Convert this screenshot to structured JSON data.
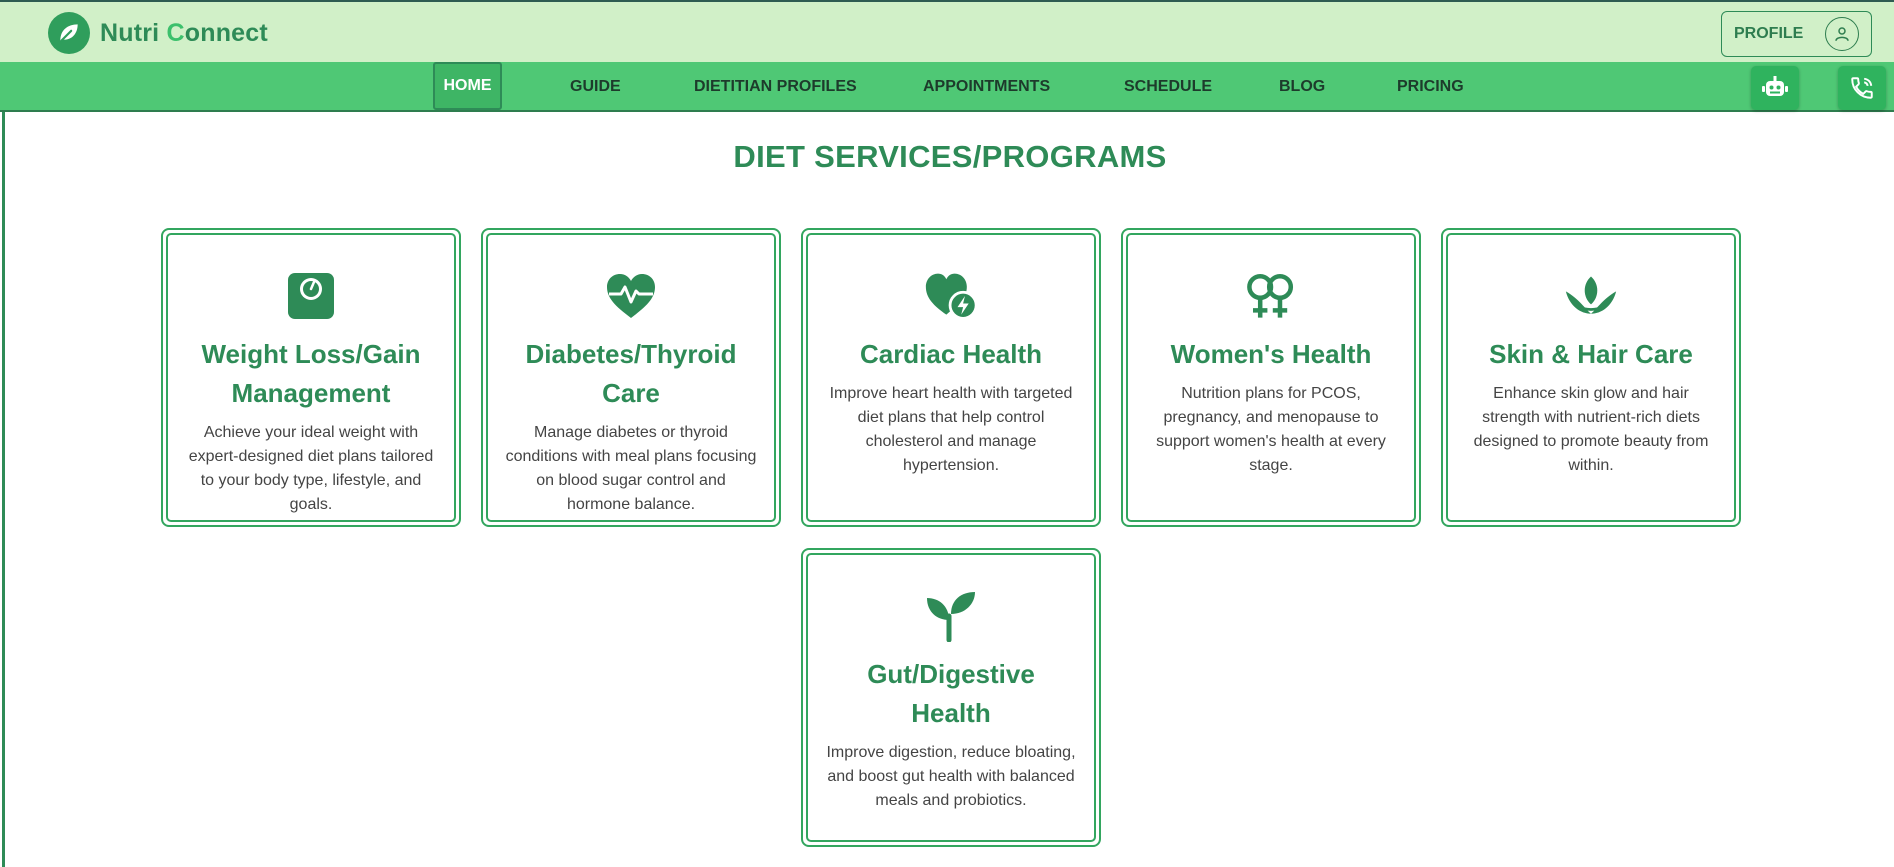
{
  "brand": {
    "name_part1": "Nutri ",
    "name_c": "C",
    "name_part2": "onnect"
  },
  "header": {
    "profile_label": "PROFILE"
  },
  "nav": {
    "items": [
      {
        "label": "HOME",
        "active": true
      },
      {
        "label": "GUIDE"
      },
      {
        "label": "DIETITIAN PROFILES"
      },
      {
        "label": "APPOINTMENTS"
      },
      {
        "label": "SCHEDULE"
      },
      {
        "label": "BLOG"
      },
      {
        "label": "PRICING"
      }
    ],
    "right_icons": [
      "robot-icon",
      "phone-icon"
    ]
  },
  "main": {
    "title": "DIET SERVICES/PROGRAMS",
    "cards": [
      {
        "icon": "weighing-scale-icon",
        "title": "Weight Loss/Gain Management",
        "description": "Achieve your ideal weight with expert-designed diet plans tailored to your body type, lifestyle, and goals."
      },
      {
        "icon": "heart-pulse-icon",
        "title": "Diabetes/Thyroid Care",
        "description": "Manage diabetes or thyroid conditions with meal plans focusing on blood sugar control and hormone balance."
      },
      {
        "icon": "heart-bolt-icon",
        "title": "Cardiac Health",
        "description": "Improve heart health with targeted diet plans that help control cholesterol and manage hypertension."
      },
      {
        "icon": "female-symbols-icon",
        "title": "Women's Health",
        "description": "Nutrition plans for PCOS, pregnancy, and menopause to support women's health at every stage."
      },
      {
        "icon": "lotus-leaf-icon",
        "title": "Skin & Hair Care",
        "description": "Enhance skin glow and hair strength with nutrient-rich diets designed to promote beauty from within."
      },
      {
        "icon": "seedling-icon",
        "title": "Gut/Digestive Health",
        "description": "Improve digestion, reduce bloating, and boost gut health with balanced meals and probiotics."
      }
    ]
  },
  "colors": {
    "primary_green": "#2e8b57",
    "nav_green": "#4fc875",
    "header_bg": "#d1f0c8"
  }
}
